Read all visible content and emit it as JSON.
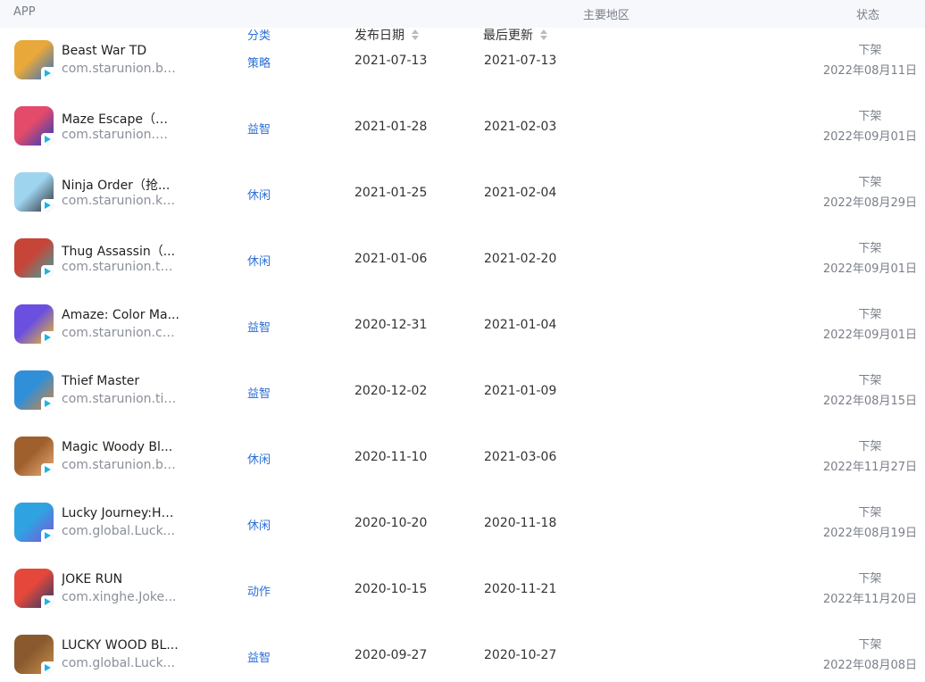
{
  "header": {
    "app": "APP",
    "category": "分类",
    "release_date": "发布日期",
    "last_update": "最后更新",
    "main_region": "主要地区",
    "status": "状态"
  },
  "rows": [
    {
      "name": "Beast War TD",
      "package": "com.starunion.be...",
      "category": "策略",
      "release": "2021-07-13",
      "update": "2021-07-13",
      "status": "下架",
      "status_date": "2022年08月11日",
      "icon": "beast-war-icon",
      "icon_colors": [
        "#e9a83a",
        "#2f6fc9"
      ]
    },
    {
      "name": "Maze Escape（抢...",
      "package": "com.starunion.m...",
      "category": "益智",
      "release": "2021-01-28",
      "update": "2021-02-03",
      "status": "下架",
      "status_date": "2022年09月01日",
      "icon": "maze-escape-icon",
      "icon_colors": [
        "#e44a6a",
        "#1f3fbf"
      ]
    },
    {
      "name": "Ninja Order（抢...",
      "package": "com.starunion.kill...",
      "category": "休闲",
      "release": "2021-01-25",
      "update": "2021-02-04",
      "status": "下架",
      "status_date": "2022年08月29日",
      "icon": "ninja-order-icon",
      "icon_colors": [
        "#9fd4ef",
        "#2b2b33"
      ]
    },
    {
      "name": "Thug Assassin（...",
      "package": "com.starunion.th...",
      "category": "休闲",
      "release": "2021-01-06",
      "update": "2021-02-20",
      "status": "下架",
      "status_date": "2022年09月01日",
      "icon": "thug-assassin-icon",
      "icon_colors": [
        "#c74438",
        "#3aa7a3"
      ]
    },
    {
      "name": "Amaze: Color Ma...",
      "package": "com.starunion.cle...",
      "category": "益智",
      "release": "2020-12-31",
      "update": "2021-01-04",
      "status": "下架",
      "status_date": "2022年09月01日",
      "icon": "amaze-color-icon",
      "icon_colors": [
        "#6a4fe0",
        "#f4c21f"
      ]
    },
    {
      "name": "Thief Master",
      "package": "com.starunion.tin...",
      "category": "益智",
      "release": "2020-12-02",
      "update": "2021-01-09",
      "status": "下架",
      "status_date": "2022年08月15日",
      "icon": "thief-master-icon",
      "icon_colors": [
        "#2f8fd8",
        "#d9853a"
      ]
    },
    {
      "name": "Magic Woody Bl...",
      "package": "com.starunion.bl...",
      "category": "休闲",
      "release": "2020-11-10",
      "update": "2021-03-06",
      "status": "下架",
      "status_date": "2022年11月27日",
      "icon": "magic-woody-icon",
      "icon_colors": [
        "#a0602e",
        "#e7b07a"
      ]
    },
    {
      "name": "Lucky Journey:Ha...",
      "package": "com.global.Lucky...",
      "category": "休闲",
      "release": "2020-10-20",
      "update": "2020-11-18",
      "status": "下架",
      "status_date": "2022年08月19日",
      "icon": "lucky-journey-icon",
      "icon_colors": [
        "#2fa3e2",
        "#7c54d6"
      ]
    },
    {
      "name": "JOKE RUN",
      "package": "com.xinghe.Joke...",
      "category": "动作",
      "release": "2020-10-15",
      "update": "2020-11-21",
      "status": "下架",
      "status_date": "2022年11月20日",
      "icon": "joke-run-icon",
      "icon_colors": [
        "#e5483b",
        "#243a6b"
      ]
    },
    {
      "name": "LUCKY WOOD BL...",
      "package": "com.global.Lucky...",
      "category": "益智",
      "release": "2020-09-27",
      "update": "2020-10-27",
      "status": "下架",
      "status_date": "2022年08月08日",
      "icon": "lucky-wood-icon",
      "icon_colors": [
        "#8a5a2e",
        "#c9904d"
      ]
    }
  ]
}
